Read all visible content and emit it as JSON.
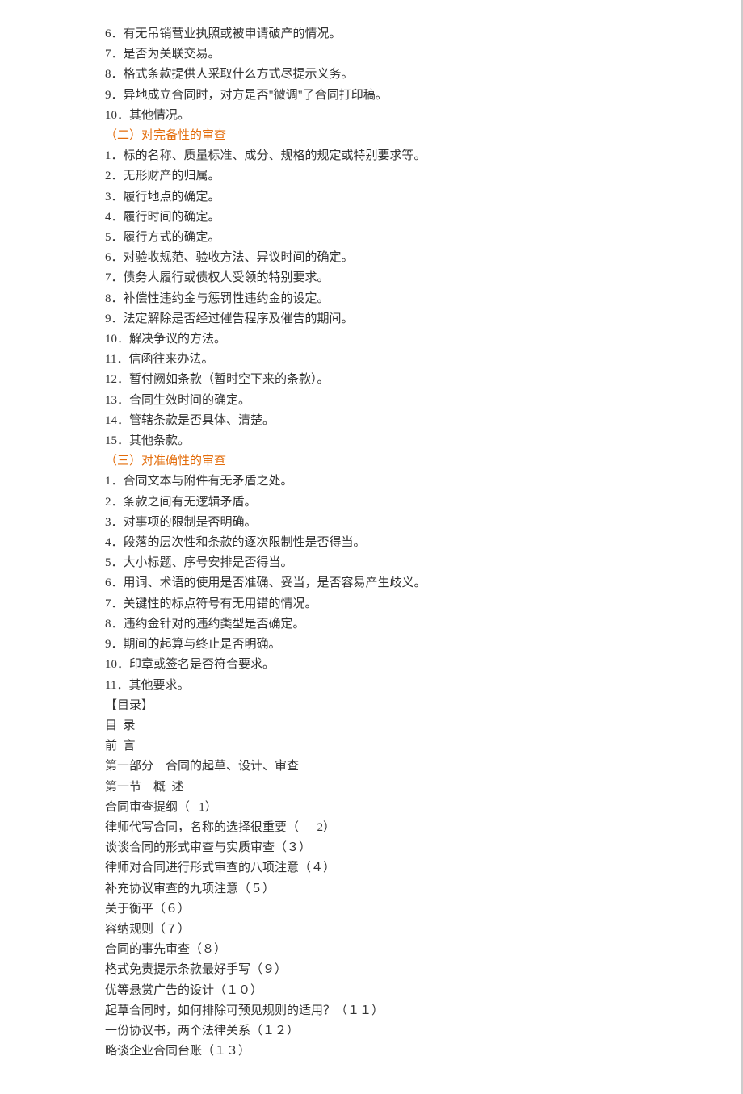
{
  "lines": [
    "6．有无吊销营业执照或被申请破产的情况。",
    "7．是否为关联交易。",
    "8．格式条款提供人采取什么方式尽提示义务。",
    "9．异地成立合同时，对方是否\"微调\"了合同打印稿。",
    "10．其他情况。",
    "（二）对完备性的审查",
    "1．标的名称、质量标准、成分、规格的规定或特别要求等。",
    "2．无形财产的归属。",
    "3．履行地点的确定。",
    "4．履行时间的确定。",
    "5．履行方式的确定。",
    "6．对验收规范、验收方法、异议时间的确定。",
    "7．债务人履行或债权人受领的特别要求。",
    "8．补偿性违约金与惩罚性违约金的设定。",
    "9．法定解除是否经过催告程序及催告的期间。",
    "10．解决争议的方法。",
    "11．信函往来办法。",
    "12．暂付阙如条款（暂时空下来的条款）。",
    "13．合同生效时间的确定。",
    "14．管辖条款是否具体、清楚。",
    "15．其他条款。",
    "（三）对准确性的审查",
    "1．合同文本与附件有无矛盾之处。",
    "2．条款之间有无逻辑矛盾。",
    "3．对事项的限制是否明确。",
    "4．段落的层次性和条款的逐次限制性是否得当。",
    "5．大小标题、序号安排是否得当。",
    "6．用词、术语的使用是否准确、妥当，是否容易产生歧义。",
    "7．关键性的标点符号有无用错的情况。",
    "8．违约金针对的违约类型是否确定。",
    "9．期间的起算与终止是否明确。",
    "10．印章或签名是否符合要求。",
    "11．其他要求。",
    "【目录】",
    "目  录",
    "前  言",
    "第一部分    合同的起草、设计、审查",
    "第一节    概  述",
    "合同审查提纲（   1）",
    "律师代写合同，名称的选择很重要（      2）",
    "谈谈合同的形式审查与实质审查（３）",
    "律师对合同进行形式审查的八项注意（４）",
    "补充协议审查的九项注意（５）",
    "关于衡平（６）",
    "容纳规则（７）",
    "合同的事先审查（８）",
    "格式免责提示条款最好手写（９）",
    "优等悬赏广告的设计（１０）",
    "起草合同时，如何排除可预见规则的适用？（１１）",
    "一份协议书，两个法律关系（１２）",
    "略谈企业合同台账（１３）"
  ],
  "orange_indices": [
    5,
    21
  ]
}
